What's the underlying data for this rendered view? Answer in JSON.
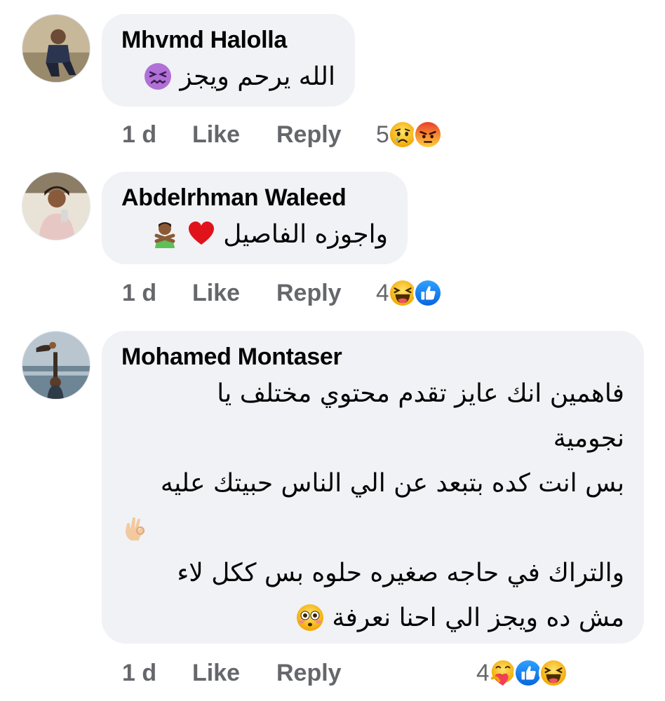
{
  "comments": [
    {
      "author": "Mhvmd Halolla",
      "text_lines": [
        "الله يرحم ويجز"
      ],
      "text_emoji": "confounded-face",
      "time": "1 d",
      "like": "Like",
      "reply": "Reply",
      "reaction_count": "5",
      "reactions": [
        "sad",
        "angry"
      ]
    },
    {
      "author": "Abdelrhman Waleed",
      "text_lines": [
        "واجوزه الفاصيل"
      ],
      "text_emoji": "red-heart, person-gesturing-no",
      "time": "1 d",
      "like": "Like",
      "reply": "Reply",
      "reaction_count": "4",
      "reactions": [
        "haha",
        "like"
      ]
    },
    {
      "author": "Mohamed Montaser",
      "text_lines": [
        "فاهمين انك عايز تقدم محتوي مختلف يا",
        "نجومية",
        "بس انت كده بتبعد عن الي الناس حبيتك عليه",
        "والتراك في حاجه صغيره حلوه بس ككل لاء",
        "مش ده ويجز الي احنا نعرفة"
      ],
      "text_emoji": "ok-hand, flushed-face",
      "time": "1 d",
      "like": "Like",
      "reply": "Reply",
      "reaction_count": "4",
      "reactions": [
        "care",
        "like",
        "haha"
      ]
    }
  ],
  "colors": {
    "bubble": "#f0f2f5",
    "meta_text": "#65676b",
    "like_blue": "#1877f2",
    "angry": "#f15b3a",
    "emoji_yellow": "#f7b125"
  }
}
